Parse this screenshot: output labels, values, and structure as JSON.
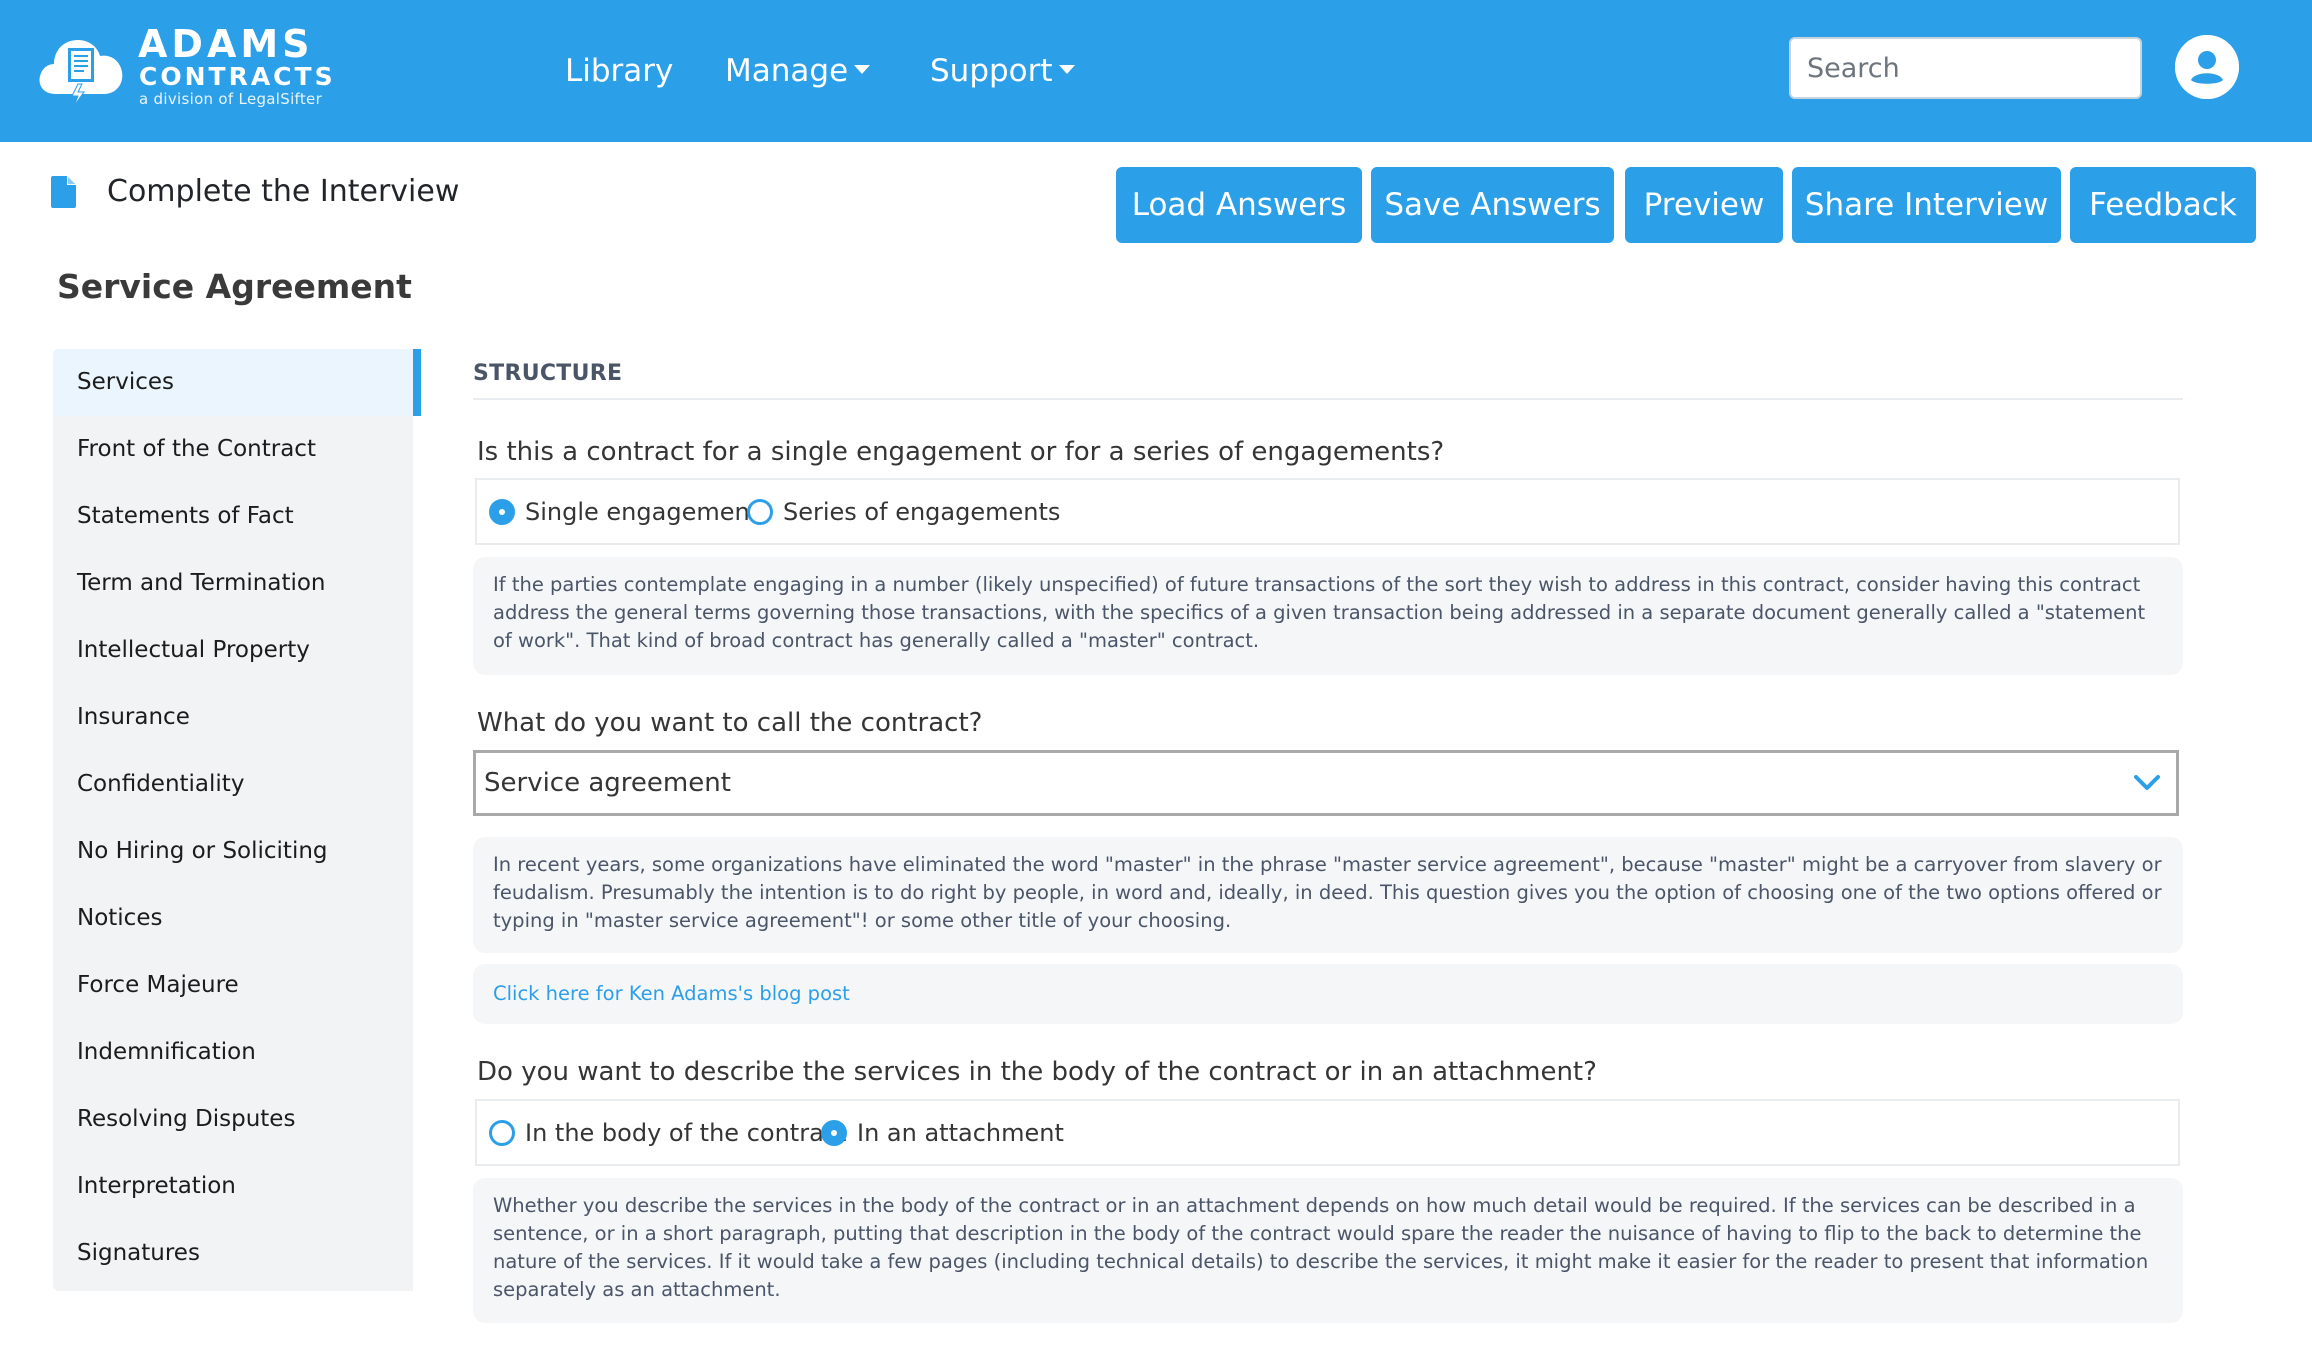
{
  "brand": {
    "name": "ADAMS",
    "sub": "CONTRACTS",
    "division": "a division of LegalSifter",
    "accent": "#2c9fe9"
  },
  "nav": {
    "items": [
      {
        "label": "Library",
        "has_caret": false
      },
      {
        "label": "Manage",
        "has_caret": true
      },
      {
        "label": "Support",
        "has_caret": true
      }
    ],
    "search_placeholder": "Search",
    "user_icon": "user-circle-icon"
  },
  "page": {
    "title": "Complete the Interview",
    "title_icon": "document-icon",
    "document_title": "Service Agreement"
  },
  "actions": [
    {
      "label": "Load Answers"
    },
    {
      "label": "Save Answers"
    },
    {
      "label": "Preview"
    },
    {
      "label": "Share Interview"
    },
    {
      "label": "Feedback"
    }
  ],
  "sidebar": {
    "active_index": 0,
    "items": [
      {
        "label": "Services"
      },
      {
        "label": "Front of the Contract"
      },
      {
        "label": "Statements of Fact"
      },
      {
        "label": "Term and Termination"
      },
      {
        "label": "Intellectual Property"
      },
      {
        "label": "Insurance"
      },
      {
        "label": "Confidentiality"
      },
      {
        "label": "No Hiring or Soliciting"
      },
      {
        "label": "Notices"
      },
      {
        "label": "Force Majeure"
      },
      {
        "label": "Indemnification"
      },
      {
        "label": "Resolving Disputes"
      },
      {
        "label": "Interpretation"
      },
      {
        "label": "Signatures"
      }
    ]
  },
  "main": {
    "section_heading": "STRUCTURE",
    "q1": {
      "question": "Is this a contract for a single engagement or for a series of engagements?",
      "options": [
        {
          "label": "Single engagement",
          "selected": true
        },
        {
          "label": "Series of engagements",
          "selected": false
        }
      ],
      "help": "If the parties contemplate engaging in a number (likely unspecified) of future transactions of the sort they wish to address in this contract, consider having this contract address the general terms governing those transactions, with the specifics of a given transaction being addressed in a separate document generally called a \"statement of work\". That kind of broad contract has generally called a \"master\" contract."
    },
    "q2": {
      "question": "What do you want to call the contract?",
      "selected_value": "Service agreement",
      "help": "In recent years, some organizations have eliminated the word \"master\" in the phrase \"master service agreement\", because \"master\" might be a carryover from slavery or feudalism. Presumably the intention is to do right by people, in word and, ideally, in deed. This question gives you the option of choosing one of the two options offered or typing in \"master service agreement\"! or some other title of your choosing.",
      "link": "Click here for Ken Adams's blog post"
    },
    "q3": {
      "question": "Do you want to describe the services in the body of the contract or in an attachment?",
      "options": [
        {
          "label": "In the body of the contract",
          "selected": false
        },
        {
          "label": "In an attachment",
          "selected": true
        }
      ],
      "help": "Whether you describe the services in the body of the contract or in an attachment depends on how much detail would be required. If the services can be described in a sentence, or in a short paragraph, putting that description in the body of the contract would spare the reader the nuisance of having to flip to the back to determine the nature of the services. If it would take a few pages (including technical details) to describe the services, it might make it easier for the reader to present that information separately as an attachment."
    }
  }
}
